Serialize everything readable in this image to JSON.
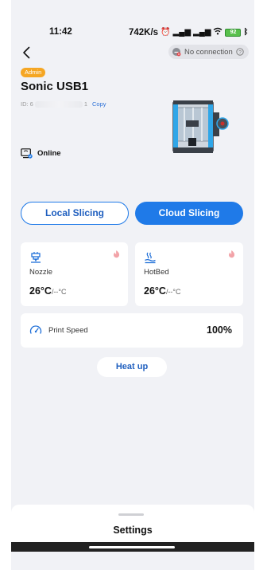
{
  "status_bar": {
    "time": "11:42",
    "speed": "742K/s",
    "battery": "92"
  },
  "header": {
    "connection_label": "No connection"
  },
  "device": {
    "role_badge": "Admin",
    "name": "Sonic USB1",
    "id_prefix": "ID: 6",
    "id_suffix": "1",
    "copy_label": "Copy",
    "online_label": "Online"
  },
  "slicing": {
    "local_label": "Local Slicing",
    "cloud_label": "Cloud Slicing"
  },
  "nozzle": {
    "label": "Nozzle",
    "current": "26°C",
    "target": "/--°C"
  },
  "hotbed": {
    "label": "HotBed",
    "current": "26°C",
    "target": "/--°C"
  },
  "print_speed": {
    "label": "Print Speed",
    "value": "100%"
  },
  "actions": {
    "heat_up_label": "Heat up"
  },
  "sheet": {
    "title": "Settings"
  },
  "colors": {
    "accent": "#1f7ae8",
    "badge": "#f5a623",
    "background": "#f1f2f6"
  }
}
